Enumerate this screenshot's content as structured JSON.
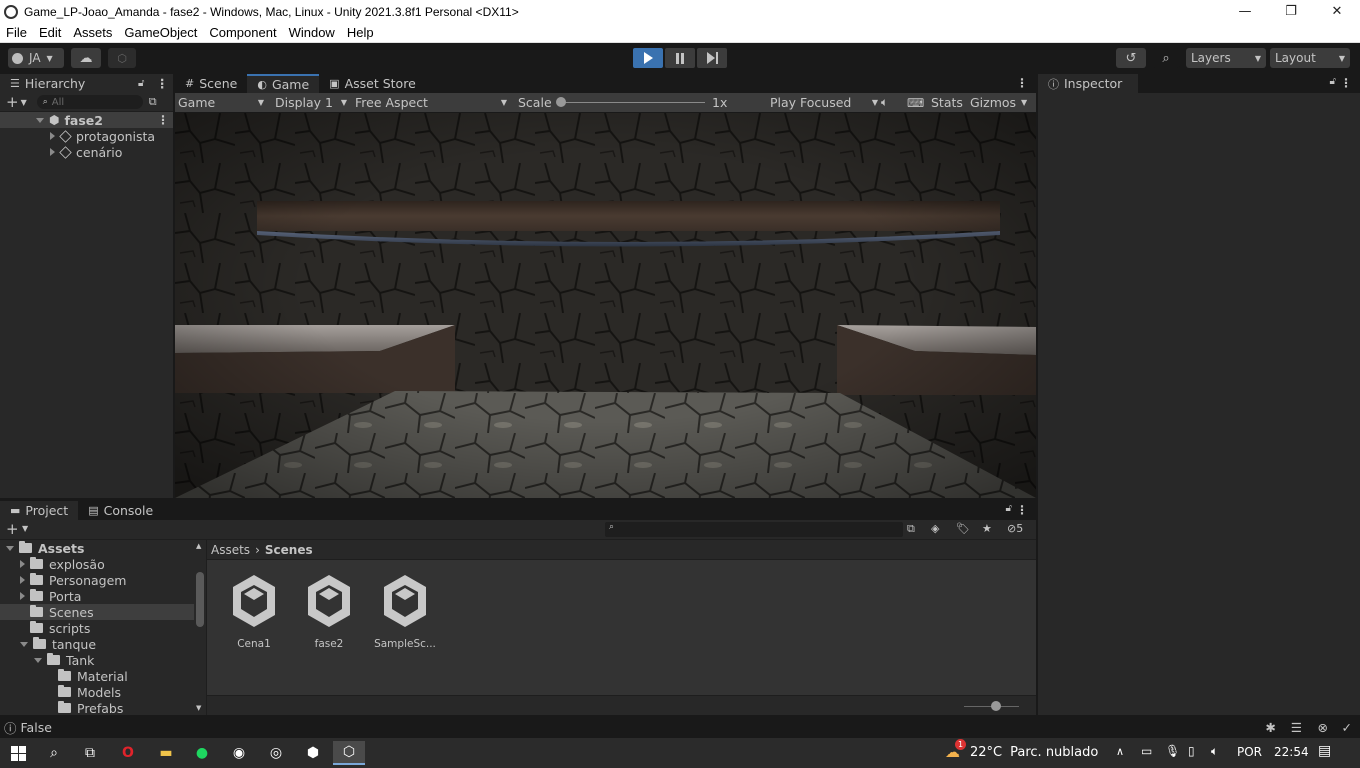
{
  "window": {
    "title": "Game_LP-Joao_Amanda - fase2 - Windows, Mac, Linux - Unity 2021.3.8f1 Personal <DX11>",
    "minimize": "—",
    "maximize": "❐",
    "close": "✕"
  },
  "menu": [
    "File",
    "Edit",
    "Assets",
    "GameObject",
    "Component",
    "Window",
    "Help"
  ],
  "toolbar": {
    "account": "JA",
    "layers": "Layers",
    "layout": "Layout"
  },
  "hierarchy": {
    "tab": "Hierarchy",
    "search_placeholder": "All",
    "scene": "fase2",
    "children": [
      "protagonista",
      "cenário"
    ]
  },
  "center_tabs": [
    "Scene",
    "Game",
    "Asset Store"
  ],
  "game_bar": {
    "mode": "Game",
    "display": "Display 1",
    "aspect": "Free Aspect",
    "scale_label": "Scale",
    "scale_value": "1x",
    "play_mode": "Play Focused",
    "stats": "Stats",
    "gizmos": "Gizmos"
  },
  "inspector": {
    "tab": "Inspector"
  },
  "bottom_tabs": [
    "Project",
    "Console"
  ],
  "project": {
    "visible_count": "5",
    "tree": [
      {
        "label": "Assets",
        "depth": 0,
        "expanded": true,
        "selected": false
      },
      {
        "label": "explosão",
        "depth": 1,
        "expanded": false,
        "selected": false
      },
      {
        "label": "Personagem",
        "depth": 1,
        "expanded": false,
        "selected": false
      },
      {
        "label": "Porta",
        "depth": 1,
        "expanded": false,
        "selected": false
      },
      {
        "label": "Scenes",
        "depth": 1,
        "expanded": null,
        "selected": true
      },
      {
        "label": "scripts",
        "depth": 1,
        "expanded": null,
        "selected": false
      },
      {
        "label": "tanque",
        "depth": 1,
        "expanded": true,
        "selected": false
      },
      {
        "label": "Tank",
        "depth": 2,
        "expanded": true,
        "selected": false
      },
      {
        "label": "Material",
        "depth": 3,
        "expanded": null,
        "selected": false
      },
      {
        "label": "Models",
        "depth": 3,
        "expanded": null,
        "selected": false
      },
      {
        "label": "Prefabs",
        "depth": 3,
        "expanded": null,
        "selected": false
      }
    ],
    "breadcrumb": [
      "Assets",
      "Scenes"
    ],
    "assets": [
      "Cena1",
      "fase2",
      "SampleSc..."
    ]
  },
  "status": {
    "message": "False"
  },
  "taskbar": {
    "weather_temp": "22°C",
    "weather_desc": "Parc. nublado",
    "weather_badge": "1",
    "language": "POR",
    "time": "22:54"
  },
  "colors": {
    "play_active": "#3a72b0",
    "selected_row": "#3e3e3e",
    "panel_bg": "#282828"
  }
}
